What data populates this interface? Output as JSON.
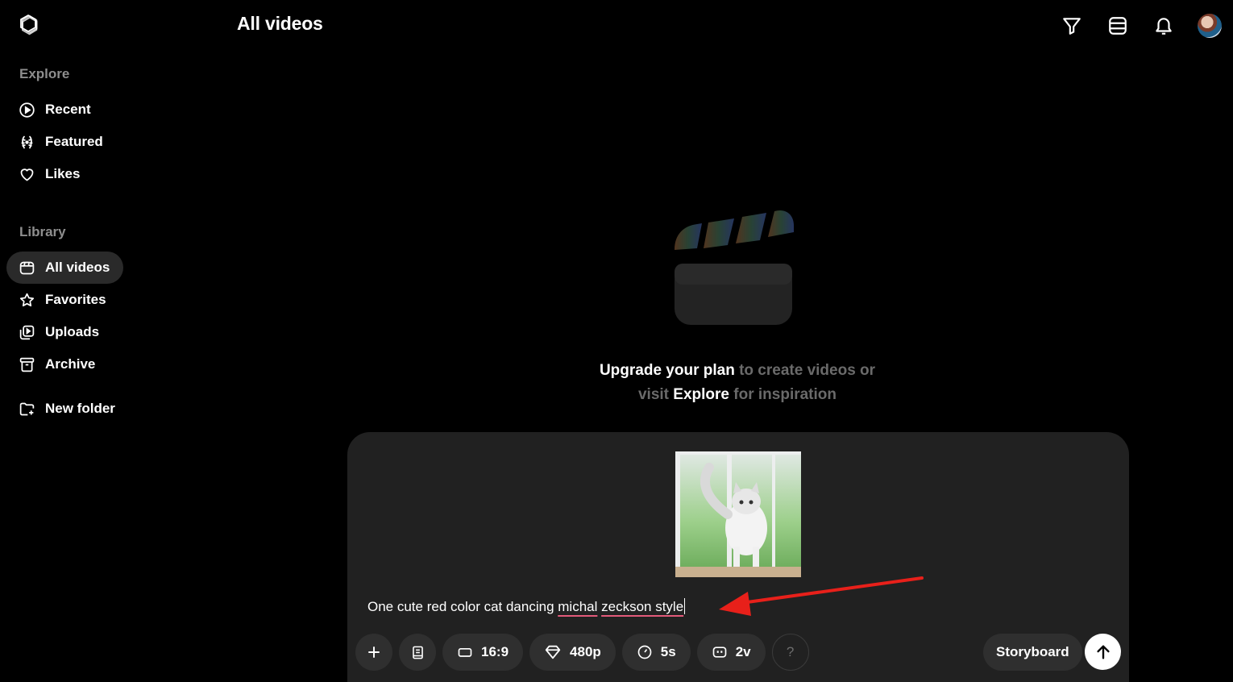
{
  "header": {
    "title": "All videos",
    "icons": [
      "filter-icon",
      "list-view-icon",
      "bell-icon",
      "avatar"
    ]
  },
  "sidebar": {
    "explore_label": "Explore",
    "explore_items": [
      {
        "label": "Recent",
        "icon": "play-circle-icon"
      },
      {
        "label": "Featured",
        "icon": "laurel-icon"
      },
      {
        "label": "Likes",
        "icon": "heart-icon"
      }
    ],
    "library_label": "Library",
    "library_items": [
      {
        "label": "All videos",
        "icon": "video-library-icon",
        "active": true
      },
      {
        "label": "Favorites",
        "icon": "star-icon"
      },
      {
        "label": "Uploads",
        "icon": "upload-video-icon"
      },
      {
        "label": "Archive",
        "icon": "archive-icon"
      }
    ],
    "new_folder_label": "New folder"
  },
  "empty_state": {
    "line1_highlight": "Upgrade your plan",
    "line1_rest": " to create videos or",
    "line2_pre": "visit ",
    "line2_highlight": "Explore",
    "line2_rest": " for inspiration"
  },
  "composer": {
    "attachment": "cat-image-thumbnail",
    "prompt": {
      "part1": "One cute red color cat dancing ",
      "misspelled1": "michal",
      "space": " ",
      "misspelled2": "zeckson style"
    },
    "toolbar": {
      "aspect_ratio": "16:9",
      "resolution": "480p",
      "duration": "5s",
      "variations": "2v",
      "help": "?"
    },
    "storyboard_label": "Storyboard"
  },
  "colors": {
    "background": "#000000",
    "composer_bg": "#212121",
    "chip_bg": "#2f2f2f",
    "annotation_arrow": "#e8201a",
    "spellcheck_underline": "#e35a7a"
  }
}
